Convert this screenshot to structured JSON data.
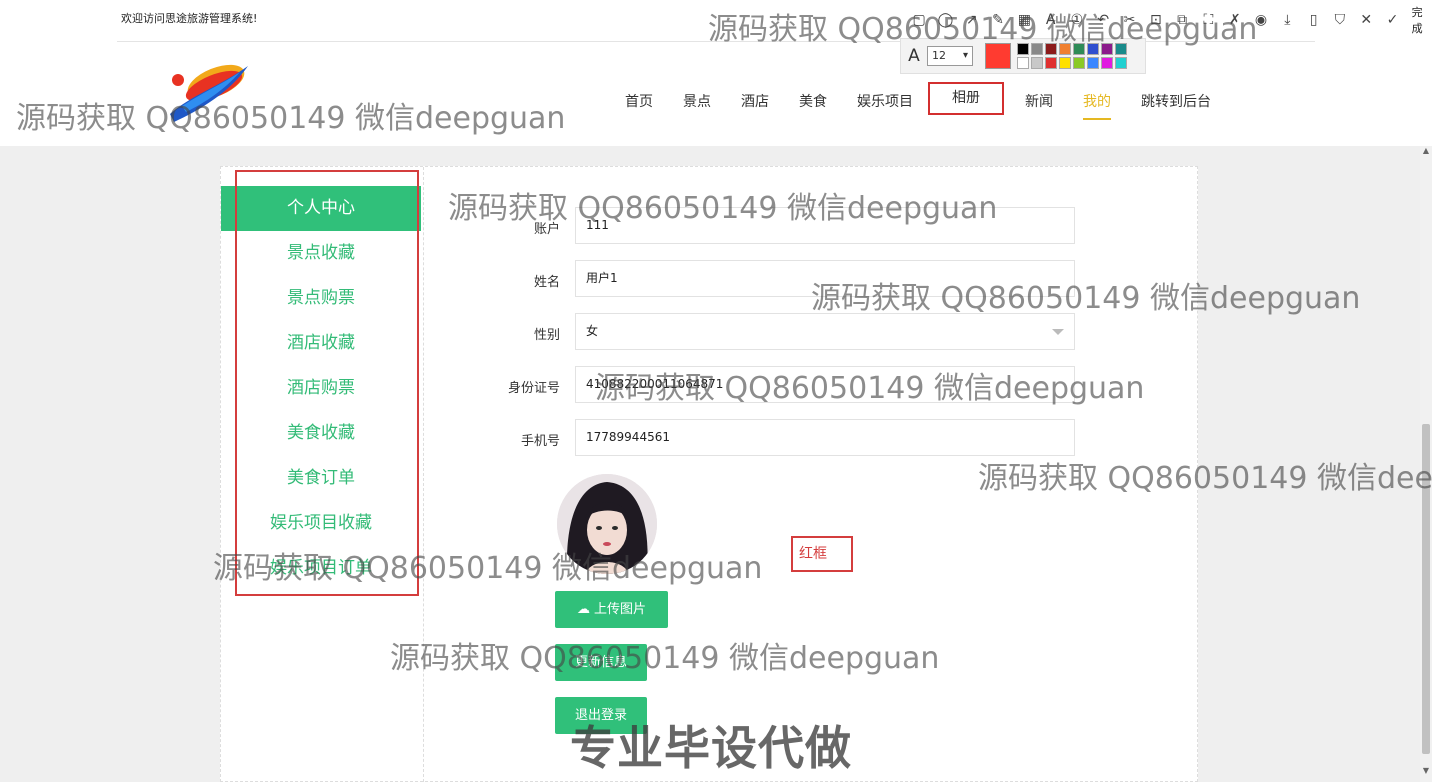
{
  "header": {
    "welcome": "欢迎访问思途旅游管理系统!",
    "nav": [
      {
        "label": "首页"
      },
      {
        "label": "景点"
      },
      {
        "label": "酒店"
      },
      {
        "label": "美食"
      },
      {
        "label": "娱乐项目"
      },
      {
        "label": "相册"
      },
      {
        "label": "新闻"
      },
      {
        "label": "我的"
      },
      {
        "label": "跳转到后台"
      }
    ],
    "active_nav": "我的"
  },
  "annotation_toolbar": {
    "done_label": "完成",
    "font_size": "12",
    "current_color": "#ff3b30",
    "palette": [
      "#000000",
      "#888888",
      "#8b1a1a",
      "#f08030",
      "#2e8b57",
      "#2f4fcf",
      "#8b1a8b",
      "#1a8b8b",
      "#ffffff",
      "#c8c8c8",
      "#e03030",
      "#ffe000",
      "#8ac926",
      "#3a86ff",
      "#e01ae0",
      "#20d0d0"
    ]
  },
  "sidebar": {
    "items": [
      {
        "label": "个人中心"
      },
      {
        "label": "景点收藏"
      },
      {
        "label": "景点购票"
      },
      {
        "label": "酒店收藏"
      },
      {
        "label": "酒店购票"
      },
      {
        "label": "美食收藏"
      },
      {
        "label": "美食订单"
      },
      {
        "label": "娱乐项目收藏"
      },
      {
        "label": "娱乐项目订单"
      }
    ]
  },
  "form": {
    "account_label": "账户",
    "account_value": "111",
    "name_label": "姓名",
    "name_value": "用户1",
    "gender_label": "性别",
    "gender_value": "女",
    "idcard_label": "身份证号",
    "idcard_value": "410882200011064871",
    "phone_label": "手机号",
    "phone_value": "17789944561",
    "upload_label": "上传图片",
    "update_label": "更新信息",
    "logout_label": "退出登录"
  },
  "annotation_text": "红框",
  "watermarks": {
    "text": "源码获取 QQ86050149 微信deepguan",
    "big": "专业毕设代做"
  },
  "colors": {
    "accent": "#30c07a",
    "active_nav": "#e5b822",
    "annotation": "#d43d3d"
  }
}
